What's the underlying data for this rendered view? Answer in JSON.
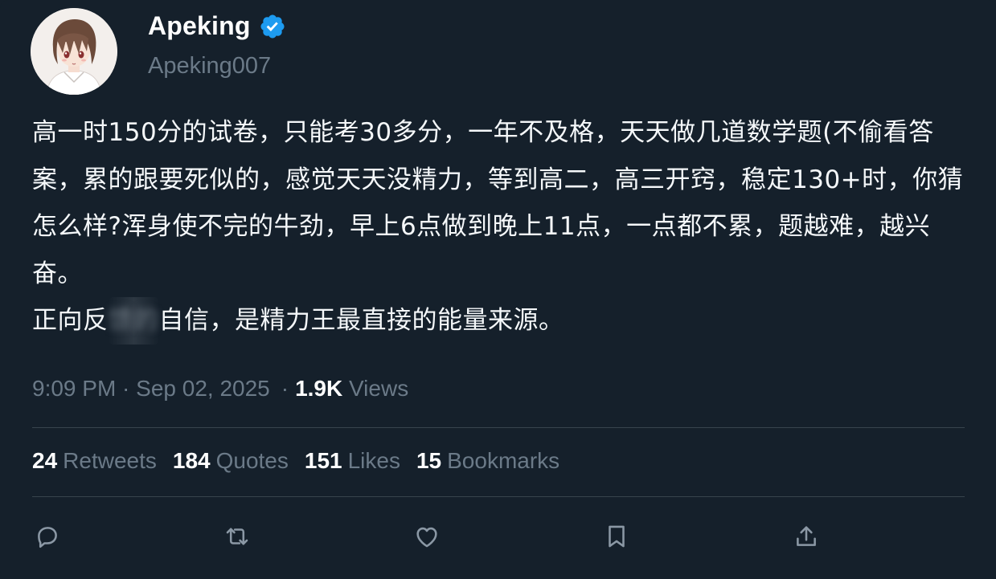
{
  "author": {
    "display_name": "Apeking",
    "handle": "Apeking007",
    "verified": true,
    "avatar_icon": "anime-avatar-icon"
  },
  "tweet": {
    "paragraph1": "高一时150分的试卷，只能考30多分，一年不及格，天天做几道数学题(不偷看答案，累的跟要死似的，感觉天天没精力，等到高二，高三开窍，稳定130+时，你猜怎么样?浑身使不完的牛劲，早上6点做到晚上11点，一点都不累，题越难，越兴奋。",
    "paragraph2_before": "正向反",
    "paragraph2_blurred": "馈的",
    "paragraph2_after": "自信，是精力王最直接的能量来源。"
  },
  "meta": {
    "timestamp": "9:09 PM · Sep 02, 2025",
    "separator": "·",
    "views_count": "1.9K",
    "views_label": "Views"
  },
  "stats": {
    "retweets_count": "24",
    "retweets_label": "Retweets",
    "quotes_count": "184",
    "quotes_label": "Quotes",
    "likes_count": "151",
    "likes_label": "Likes",
    "bookmarks_count": "15",
    "bookmarks_label": "Bookmarks"
  },
  "actions": {
    "reply_icon": "reply-icon",
    "retweet_icon": "retweet-icon",
    "like_icon": "heart-icon",
    "bookmark_icon": "bookmark-icon",
    "share_icon": "share-icon"
  },
  "colors": {
    "background": "#15202b",
    "text_primary": "#ffffff",
    "text_secondary": "#6b7a88",
    "divider": "#38444d",
    "verified_blue": "#1d9bf0"
  }
}
